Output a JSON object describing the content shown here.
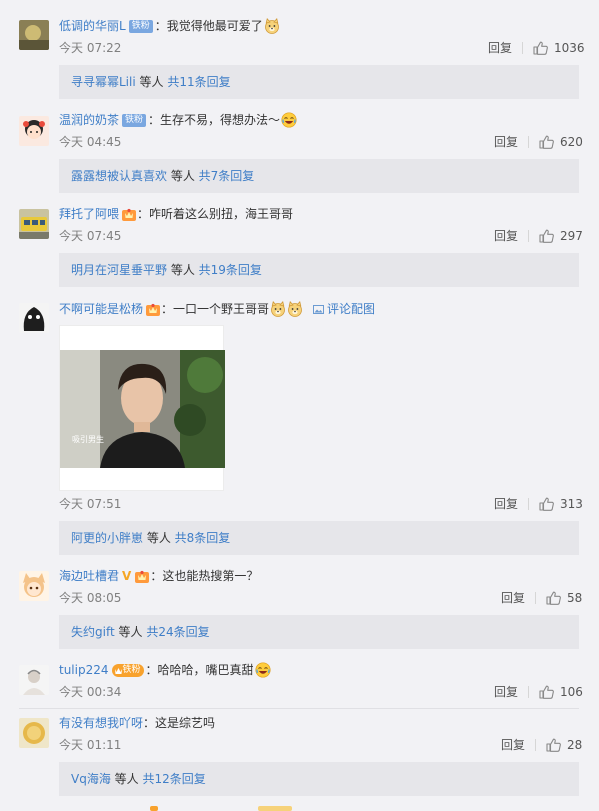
{
  "comments": [
    {
      "username": "低调的华丽L",
      "badge": "铁粉",
      "text": "：我觉得他最可爱了",
      "emoji_count": 1,
      "time": "今天 07:22",
      "reply_label": "回复",
      "likes": "1036",
      "replies": {
        "names": "寻寻幂幂Lili",
        "middle": " 等人 ",
        "count": "共11条回复"
      }
    },
    {
      "username": "温润的奶茶",
      "badge": "铁粉",
      "text": "：生存不易，得想办法～",
      "emoji_count": 1,
      "time": "今天 04:45",
      "reply_label": "回复",
      "likes": "620",
      "replies": {
        "names": "露露想被认真喜欢",
        "middle": " 等人 ",
        "count": "共7条回复"
      }
    },
    {
      "username": "拜托了阿喂",
      "text": "：咋听着这么别扭，海王哥哥",
      "time": "今天 07:45",
      "reply_label": "回复",
      "likes": "297",
      "replies": {
        "names": "明月在河星垂平野",
        "middle": " 等人 ",
        "count": "共19条回复"
      }
    },
    {
      "username": "不啊可能是松杨",
      "text": "：一口一个野王哥哥",
      "emoji_count": 2,
      "pic_link": "评论配图",
      "photo_caption": "吸引男生",
      "time": "今天 07:51",
      "reply_label": "回复",
      "likes": "313",
      "replies": {
        "names": "阿更的小胖崽",
        "middle": " 等人 ",
        "count": "共8条回复"
      }
    },
    {
      "username": "海边吐槽君",
      "badge_v": "V",
      "text": "：这也能热搜第一？",
      "time": "今天 08:05",
      "reply_label": "回复",
      "likes": "58",
      "replies": {
        "names": "失约gift",
        "middle": " 等人 ",
        "count": "共24条回复"
      }
    },
    {
      "username": "tulip224",
      "badge_gold": "铁粉",
      "text": "：哈哈哈，嘴巴真甜",
      "emoji_count": 1,
      "time": "今天 00:34",
      "reply_label": "回复",
      "likes": "106"
    },
    {
      "username": "有没有想我吖呀",
      "text": "：这是综艺吗",
      "time": "今天 01:11",
      "reply_label": "回复",
      "likes": "28",
      "replies": {
        "names": "Vq海海",
        "middle": " 等人 ",
        "count": "共12条回复"
      }
    }
  ],
  "colors": {
    "link": "#3f7ec7",
    "background": "#f2f2f5",
    "reply_box": "#e6e6ea",
    "badge_blue": "#7aa7e0",
    "badge_gold": "#f8a22d"
  },
  "icons": [
    "thumbs-up-icon",
    "crown-fan-icon",
    "doge-emoji-icon",
    "laugh-emoji-icon",
    "image-icon"
  ]
}
